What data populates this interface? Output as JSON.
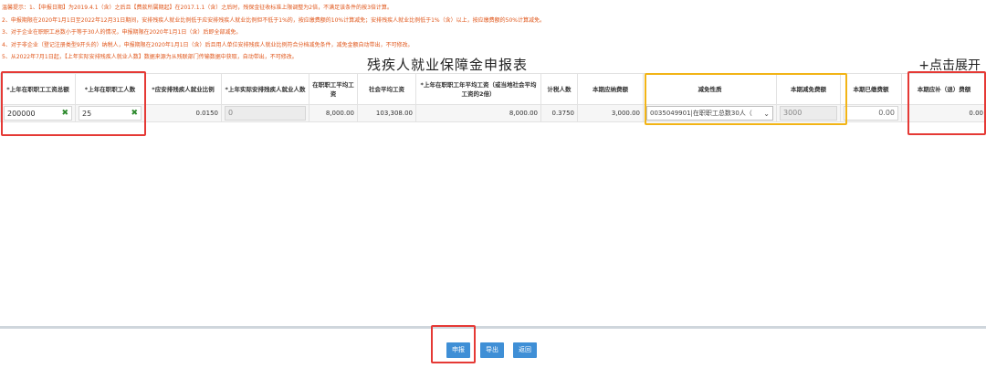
{
  "notes": [
    "温馨提示：1、【申报日期】为2019.4.1（含）之后且【费款所属期起】在2017.1.1（含）之后时，残保金征收标准上限调整为2倍，不满足该条件的按3倍计算。",
    "2、申报期限在2020年1月1日至2022年12月31日期间，安排残疾人就业比例低于应安排残疾人就业比例但不低于1%的，按应缴费额的10%计算减免；安排残疾人就业比例低于1%（含）以上，按应缴费额的50%计算减免。",
    "3、对于企业在职职工总数小于等于30人的情况，申报期限在2020年1月1日（含）后即全部减免。",
    "4、对于非企业（登记注册类型9开头的）纳税人，申报期限在2020年1月1日（含）后且用人单位安排残疾人就业比例符合分档减免条件，减免金额自动带出，不可修改。",
    "5、从2022年7月1日起，【上年实际安排残疾人就业人数】数据来源为从残联部门传输数据中获取，自动带出，不可修改。"
  ],
  "title": "残疾人就业保障金申报表",
  "expand_label": "+点击展开",
  "columns": [
    "*上年在职职工工资总额",
    "*上年在职职工人数",
    "*应安排残疾人就业比例",
    "*上年实际安排残疾人就业人数",
    "在职职工平均工资",
    "社会平均工资",
    "*上年在职职工年平均工资（或当地社会平均工资的2倍）",
    "计税人数",
    "本期应纳费额",
    "减免性质",
    "本期减免费额",
    "本期已缴费额",
    "本期应补（退）费额"
  ],
  "row": {
    "total_wages": "200000",
    "staff_count": "25",
    "required_ratio": "0.0150",
    "actual_disabled_count": "0",
    "avg_wage": "8,000.00",
    "social_avg_wage": "103,308.00",
    "annual_avg_wage": "8,000.00",
    "taxable_count": "0.3750",
    "payable_amount": "3,000.00",
    "relief_nature": "0035049901|在职职工总数30人（",
    "relief_amount": "3000",
    "paid_amount": "0.00",
    "refund_amount": "0.00"
  },
  "buttons": {
    "submit": "申报",
    "export": "导出",
    "back": "返回"
  },
  "colors": {
    "notes_text": "#e0561a",
    "button_blue": "#3f8fd6",
    "highlight_red": "#e53935",
    "highlight_yellow": "#f2b416"
  }
}
